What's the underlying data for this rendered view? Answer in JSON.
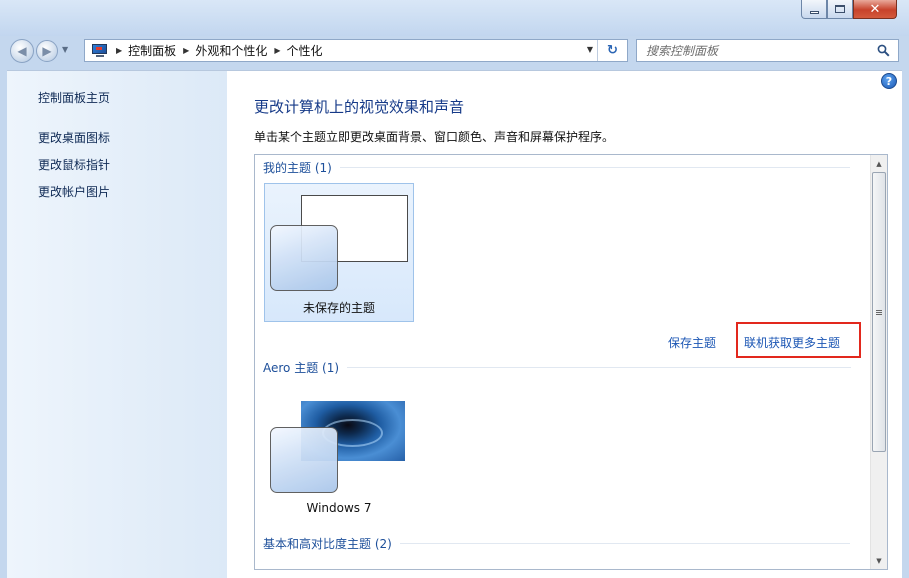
{
  "nav": {
    "breadcrumbs": [
      "控制面板",
      "外观和个性化",
      "个性化"
    ],
    "search": {
      "placeholder": "搜索控制面板"
    }
  },
  "sidebar": {
    "items": [
      {
        "label": "控制面板主页"
      },
      {
        "label": "更改桌面图标"
      },
      {
        "label": "更改鼠标指针"
      },
      {
        "label": "更改帐户图片"
      }
    ]
  },
  "main": {
    "title": "更改计算机上的视觉效果和声音",
    "subtitle": "单击某个主题立即更改桌面背景、窗口颜色、声音和屏幕保护程序。",
    "sections": {
      "my_themes": {
        "header": "我的主题 (1)"
      },
      "aero_themes": {
        "header": "Aero 主题 (1)"
      },
      "basic_themes": {
        "header": "基本和高对比度主题 (2)"
      }
    },
    "themes": {
      "unsaved": {
        "label": "未保存的主题"
      },
      "windows7": {
        "label": "Windows 7"
      }
    },
    "links": {
      "save_theme": "保存主题",
      "get_more_online": "联机获取更多主题"
    }
  },
  "icons": [
    "back-icon",
    "forward-icon",
    "control-panel-icon",
    "refresh-icon",
    "search-icon",
    "help-icon",
    "minimize-icon",
    "maximize-icon",
    "close-icon"
  ],
  "colors": {
    "highlight": "#e2281d",
    "link": "#1b56b4",
    "title": "#163a88"
  }
}
